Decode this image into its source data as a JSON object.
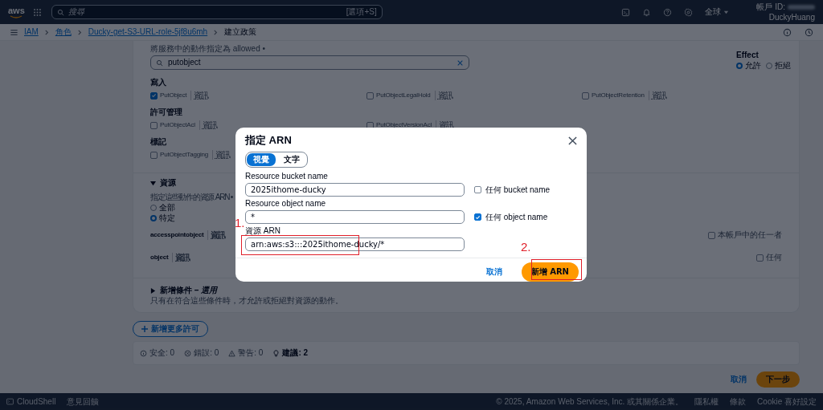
{
  "top_nav": {
    "logo": "aws",
    "search_placeholder": "搜尋",
    "search_shortcut": "[選項+S]",
    "region": "全球",
    "account_id_label": "帳戶 ID:",
    "account_name": "DuckyHuang"
  },
  "breadcrumbs": [
    {
      "label": "IAM",
      "link": true
    },
    {
      "label": "角色",
      "link": true
    },
    {
      "label": "Ducky-get-S3-URL-role-5jf8u6mh",
      "link": true
    },
    {
      "label": "建立政策",
      "link": false
    }
  ],
  "actions_panel": {
    "search_hint": "將服務中的動作指定為 allowed •",
    "search_value": "putobject",
    "effect": {
      "label": "Effect",
      "options": [
        {
          "label": "允許",
          "selected": true
        },
        {
          "label": "拒絕",
          "selected": false
        }
      ]
    },
    "groups": [
      {
        "title": "寫入",
        "actions": [
          {
            "name": "PutObject",
            "checked": true,
            "info": "資訊"
          },
          {
            "name": "PutObjectLegalHold",
            "checked": false,
            "info": "資訊"
          },
          {
            "name": "PutObjectRetention",
            "checked": false,
            "info": "資訊"
          }
        ]
      },
      {
        "title": "許可管理",
        "actions": [
          {
            "name": "PutObjectAcl",
            "checked": false,
            "info": "資訊"
          },
          {
            "name": "PutObjectVersionAcl",
            "checked": false,
            "info": "資訊"
          }
        ]
      },
      {
        "title": "標記",
        "actions": [
          {
            "name": "PutObjectTagging",
            "checked": false,
            "info": "資訊"
          }
        ]
      }
    ]
  },
  "resources": {
    "title": "資源",
    "expanded": true,
    "hint": "指定這些動作的資源 ARN •",
    "options": [
      {
        "label": "全部",
        "selected": false
      },
      {
        "label": "特定",
        "selected": true
      }
    ],
    "rows": [
      {
        "name": "accesspointobject",
        "info": "資訊",
        "any_label": "本帳戶中的任一者",
        "checked": false
      },
      {
        "name": "object",
        "info": "資訊",
        "any_label": "任何",
        "checked": false
      }
    ]
  },
  "conditions": {
    "title": "新增條件",
    "optional": "– 選用",
    "expanded": false,
    "description": "只有在符合這些條件時，才允許或拒絕對資源的動作。"
  },
  "add_permission_button": "新增更多許可",
  "validation": [
    {
      "kind": "security",
      "label": "安全: 0"
    },
    {
      "kind": "error",
      "label": "錯誤: 0"
    },
    {
      "kind": "warning",
      "label": "警告: 0"
    },
    {
      "kind": "suggestion",
      "label": "建議: 2"
    }
  ],
  "page_actions": {
    "cancel": "取消",
    "next": "下一步"
  },
  "footer": {
    "cloudshell": "CloudShell",
    "feedback": "意見回饋",
    "copyright": "© 2025, Amazon Web Services, Inc. 或其關係企業。",
    "links": [
      "隱私權",
      "條款",
      "Cookie 喜好設定"
    ]
  },
  "dialog": {
    "title": "指定 ARN",
    "modes": [
      {
        "label": "視覺",
        "selected": true
      },
      {
        "label": "文字",
        "selected": false
      }
    ],
    "fields": [
      {
        "label": "Resource bucket name",
        "value": "2025ithome-ducky",
        "any_label": "任何 bucket name",
        "any_checked": false
      },
      {
        "label": "Resource object name",
        "value": "*",
        "any_label": "任何 object name",
        "any_checked": true
      },
      {
        "label": "資源 ARN",
        "value": "arn:aws:s3:::2025ithome-ducky/*"
      }
    ],
    "cancel": "取消",
    "submit": "新增 ARN"
  },
  "annotations": [
    {
      "label": "1."
    },
    {
      "label": "2."
    }
  ]
}
